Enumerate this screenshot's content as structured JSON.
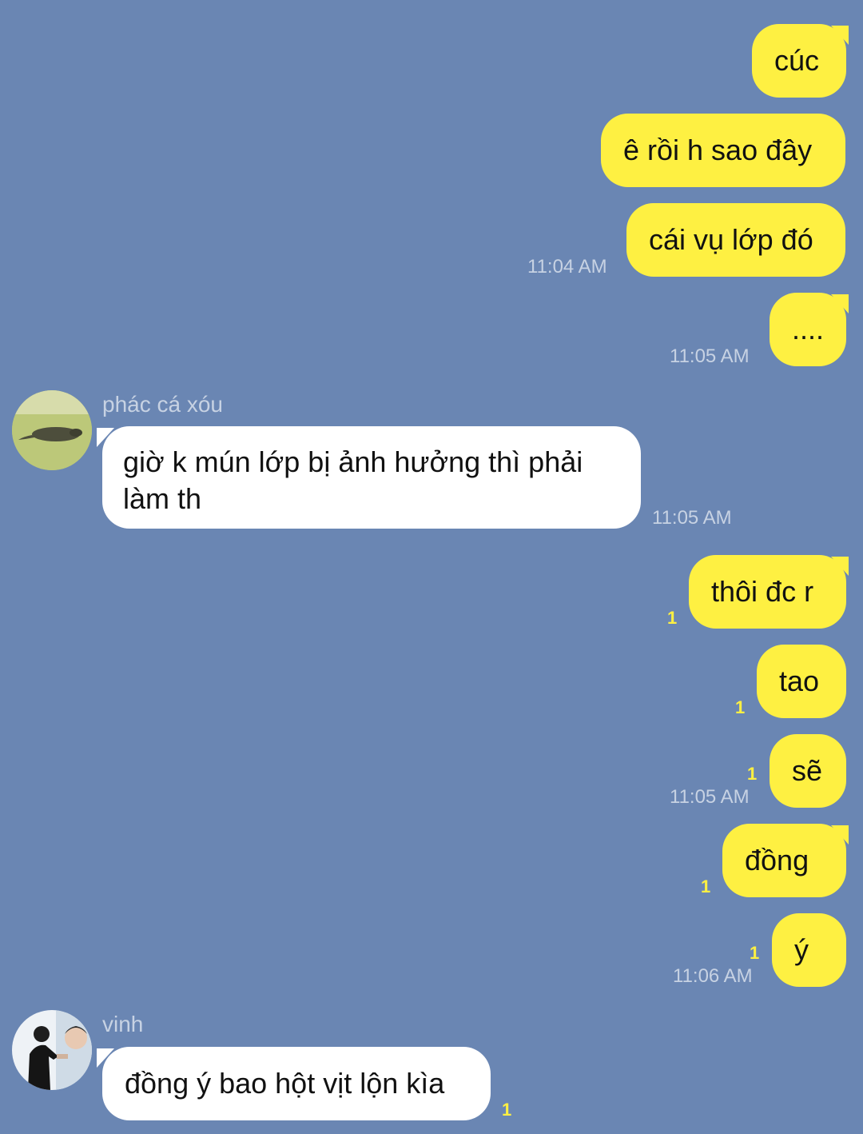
{
  "messages": [
    {
      "text": "cúc"
    },
    {
      "text": "ê rồi h sao đây"
    },
    {
      "text": "cái vụ lớp đó",
      "time": "11:04 AM"
    },
    {
      "text": "....",
      "time": "11:05 AM"
    },
    {
      "sender": "phác cá xóu",
      "text_line1": "giờ k mún lớp bị ảnh hưởng thì phải",
      "text_line2": "làm th",
      "time": "11:05 AM"
    },
    {
      "text": "thôi đc r",
      "unread": "1"
    },
    {
      "text": "tao",
      "unread": "1"
    },
    {
      "text": "sẽ",
      "unread": "1",
      "time": "11:05 AM"
    },
    {
      "text": "đồng",
      "unread": "1"
    },
    {
      "text": "ý",
      "unread": "1",
      "time": "11:06 AM"
    },
    {
      "sender": "vinh",
      "text": "đồng ý bao hột vịt lộn kìa",
      "unread": "1"
    }
  ],
  "colors": {
    "background": "#6a86b3",
    "outgoing_bubble": "#fef042",
    "incoming_bubble": "#ffffff",
    "unread_count": "#fef042"
  }
}
